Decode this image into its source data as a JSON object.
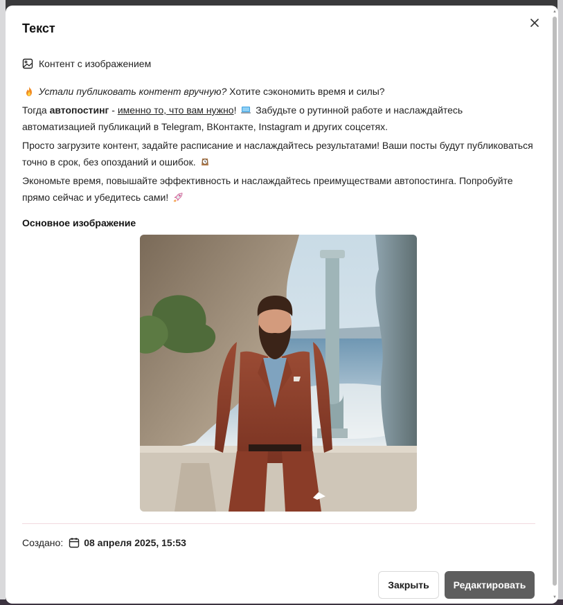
{
  "modal": {
    "title": "Текст",
    "content_type_label": "Контент с изображением",
    "body": {
      "p1_italic": "Устали публиковать контент вручную?",
      "p1_rest": " Хотите сэкономить время и силы?",
      "p2_start": "Тогда ",
      "p2_bold": "автопостинг",
      "p2_dash": " - ",
      "p2_underline": "именно то, что вам нужно",
      "p2_rest": "! ",
      "p2_rest2": " Забудьте о рутинной работе и наслаждайтесь автоматизацией публикаций в Telegram, ВКонтакте, Instagram и других соцсетях.",
      "p3": "Просто загрузите контент, задайте расписание и наслаждайтесь результатами! Ваши посты будут публиковаться точно в срок, без опозданий и ошибок. ",
      "p4": "Экономьте время, повышайте эффективность и наслаждайтесь преимуществами автопостинга. Попробуйте прямо сейчас и убедитесь сами! "
    },
    "main_image_label": "Основное изображение",
    "created_label": "Создано:",
    "created_date": "08 апреля 2025, 15:53",
    "close_button": "Закрыть",
    "edit_button": "Редактировать"
  },
  "icons": {
    "close": "close-icon",
    "content_type": "image-icon",
    "calendar": "calendar-icon",
    "emoji_fire": "fire-emoji-icon",
    "emoji_laptop": "laptop-emoji-icon",
    "emoji_clock": "clock-emoji-icon",
    "emoji_rocket": "rocket-emoji-icon"
  },
  "colors": {
    "overlay": "#2b2b2d",
    "primary_button": "#5e5e5e",
    "divider": "#f1d9de"
  }
}
